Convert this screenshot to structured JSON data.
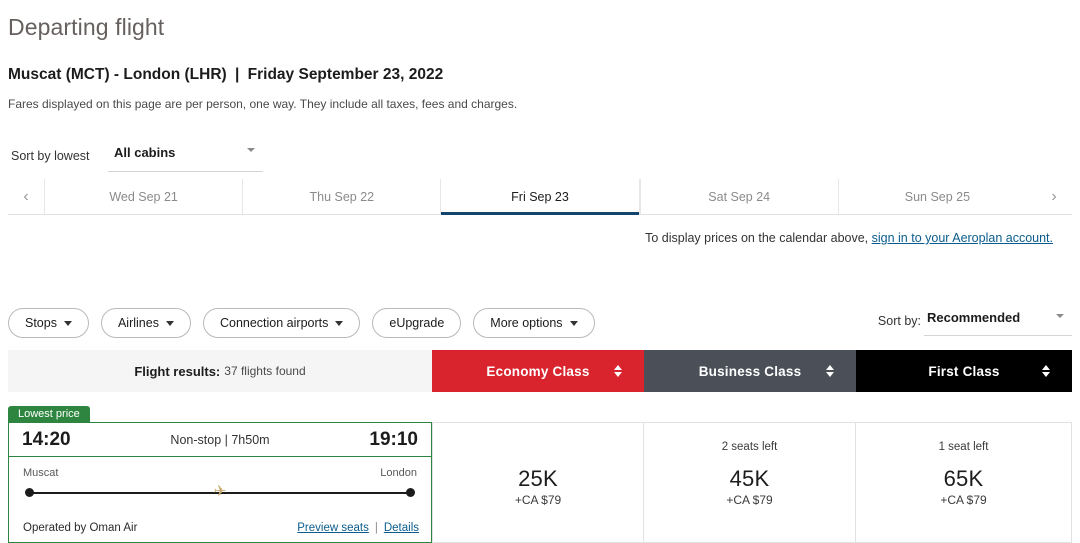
{
  "header": {
    "page_title": "Departing flight",
    "route": "Muscat (MCT) - London (LHR)",
    "separator": "|",
    "date": "Friday September 23, 2022",
    "fares_note": "Fares displayed on this page are per person, one way. They include all taxes, fees and charges."
  },
  "cabin_sort": {
    "sort_by_lowest_label": "Sort by lowest",
    "cabins_selected": "All cabins"
  },
  "date_strip": {
    "prev_icon": "‹",
    "next_icon": "›",
    "tabs": [
      {
        "label": "Wed Sep 21",
        "active": false
      },
      {
        "label": "Thu Sep 22",
        "active": false
      },
      {
        "label": "Fri Sep 23",
        "active": true
      },
      {
        "label": "Sat Sep 24",
        "active": false
      },
      {
        "label": "Sun Sep 25",
        "active": false
      }
    ]
  },
  "signin_note": {
    "text": "To display prices on the calendar above, ",
    "link": "sign in to your Aeroplan account."
  },
  "filters": [
    {
      "label": "Stops",
      "has_caret": true
    },
    {
      "label": "Airlines",
      "has_caret": true
    },
    {
      "label": "Connection airports",
      "has_caret": true
    },
    {
      "label": "eUpgrade",
      "has_caret": false
    },
    {
      "label": "More options",
      "has_caret": true
    }
  ],
  "sort_by": {
    "label": "Sort by:",
    "selected": "Recommended"
  },
  "results_header": {
    "flight_results_label": "Flight results:",
    "count_text": "37 flights found",
    "classes": [
      {
        "label": "Economy Class",
        "color": "#d9232d"
      },
      {
        "label": "Business Class",
        "color": "#4b5058"
      },
      {
        "label": "First Class",
        "color": "#000000"
      }
    ]
  },
  "flight": {
    "badge": "Lowest price",
    "depart_time": "14:20",
    "middle": "Non-stop | 7h50m",
    "arrive_time": "19:10",
    "origin": "Muscat",
    "destination": "London",
    "plane_icon": "✈",
    "operator": "Operated by Oman Air",
    "preview_seats_link": "Preview seats",
    "link_separator": "|",
    "details_link": "Details",
    "fares": [
      {
        "seats_left": "",
        "points": "25K",
        "cash": "+CA $79"
      },
      {
        "seats_left": "2 seats left",
        "points": "45K",
        "cash": "+CA $79"
      },
      {
        "seats_left": "1 seat left",
        "points": "65K",
        "cash": "+CA $79"
      }
    ]
  }
}
